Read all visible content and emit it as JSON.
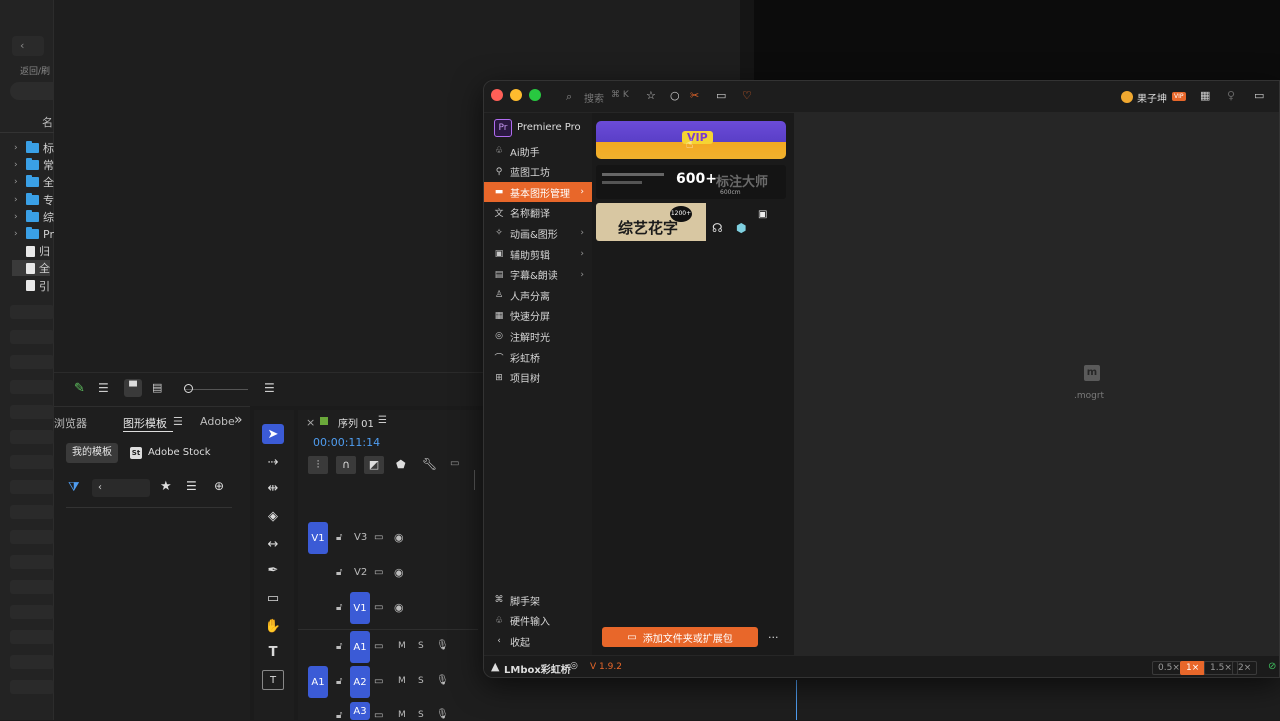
{
  "project_panel": {
    "back_label": "返回/刷",
    "col_header": "名",
    "rows": [
      {
        "type": "folder",
        "label": "标"
      },
      {
        "type": "folder",
        "label": "常"
      },
      {
        "type": "folder",
        "label": "全"
      },
      {
        "type": "folder",
        "label": "专"
      },
      {
        "type": "folder",
        "label": "综"
      },
      {
        "type": "folder",
        "label": "Pr"
      },
      {
        "type": "file",
        "label": "归"
      },
      {
        "type": "file",
        "label": "全"
      },
      {
        "type": "file",
        "label": "引"
      }
    ]
  },
  "library_panel": {
    "tabs": [
      "浏览器",
      "图形模板",
      "Adobe"
    ],
    "overflow": "»",
    "subtabs": [
      "我的模板",
      "Adobe Stock"
    ],
    "stock_badge": "St",
    "search_value": "‹"
  },
  "timeline": {
    "close": "×",
    "sequence_name": "序列 01",
    "timecode": "00:00:11:14",
    "tracks": [
      {
        "name": "V3",
        "source": "V1",
        "kind": "video"
      },
      {
        "name": "V2",
        "source": "",
        "kind": "video"
      },
      {
        "name": "V1",
        "source": "",
        "kind": "video"
      },
      {
        "name": "A1",
        "source": "",
        "kind": "audio"
      },
      {
        "name": "A2",
        "source": "A1",
        "kind": "audio"
      },
      {
        "name": "A3",
        "source": "",
        "kind": "audio"
      }
    ],
    "mute": "M",
    "solo": "S"
  },
  "plugin": {
    "search_placeholder": "搜索",
    "search_shortcut": "⌘ K",
    "user_name": "果子坤",
    "user_badge": "VIP",
    "app_label": "Premiere Pro",
    "app_badge": "Pr",
    "nav": [
      {
        "label": "Ai助手",
        "icon": "♧",
        "arrow": false,
        "active": false
      },
      {
        "label": "蓝图工坊",
        "icon": "⚲",
        "arrow": false,
        "active": false
      },
      {
        "label": "基本图形管理",
        "icon": "▬",
        "arrow": true,
        "active": true
      },
      {
        "label": "名称翻译",
        "icon": "文",
        "arrow": false,
        "active": false
      },
      {
        "label": "动画&图形",
        "icon": "✧",
        "arrow": true,
        "active": false
      },
      {
        "label": "辅助剪辑",
        "icon": "▣",
        "arrow": true,
        "active": false
      },
      {
        "label": "字幕&朗读",
        "icon": "▤",
        "arrow": true,
        "active": false
      },
      {
        "label": "人声分离",
        "icon": "♙",
        "arrow": false,
        "active": false
      },
      {
        "label": "快速分屏",
        "icon": "▦",
        "arrow": false,
        "active": false
      },
      {
        "label": "注解时光",
        "icon": "◎",
        "arrow": false,
        "active": false
      },
      {
        "label": "彩虹桥",
        "icon": "⌒",
        "arrow": false,
        "active": false
      },
      {
        "label": "项目树",
        "icon": "⊞",
        "arrow": false,
        "active": false
      }
    ],
    "nav_bottom": [
      {
        "label": "脚手架",
        "icon": "⌘"
      },
      {
        "label": "硬件输入",
        "icon": "♧"
      },
      {
        "label": "收起",
        "icon": "‹"
      }
    ],
    "add_button": "添加文件夹或扩展包",
    "more": "···",
    "thumb_banner_text": "VIP",
    "thumb_big_text": "600+",
    "thumb_big_sub": "标注大师",
    "thumb_big_unit": "600cm",
    "thumb_c_badge": "1200+",
    "thumb_c_text": "综艺花字",
    "preview_badge": "m",
    "preview_label": ".mogrt",
    "brand": "LMbox彩虹桥",
    "version": "V 1.9.2",
    "zoom_levels": [
      "0.5×",
      "1×",
      "1.5×",
      "2×"
    ],
    "zoom_active": 1,
    "colors": {
      "accent": "#e8672a",
      "track_blue": "#3b5bd6",
      "close": "#ff5f57",
      "minimize": "#febc2e",
      "maximize": "#28c840"
    }
  }
}
